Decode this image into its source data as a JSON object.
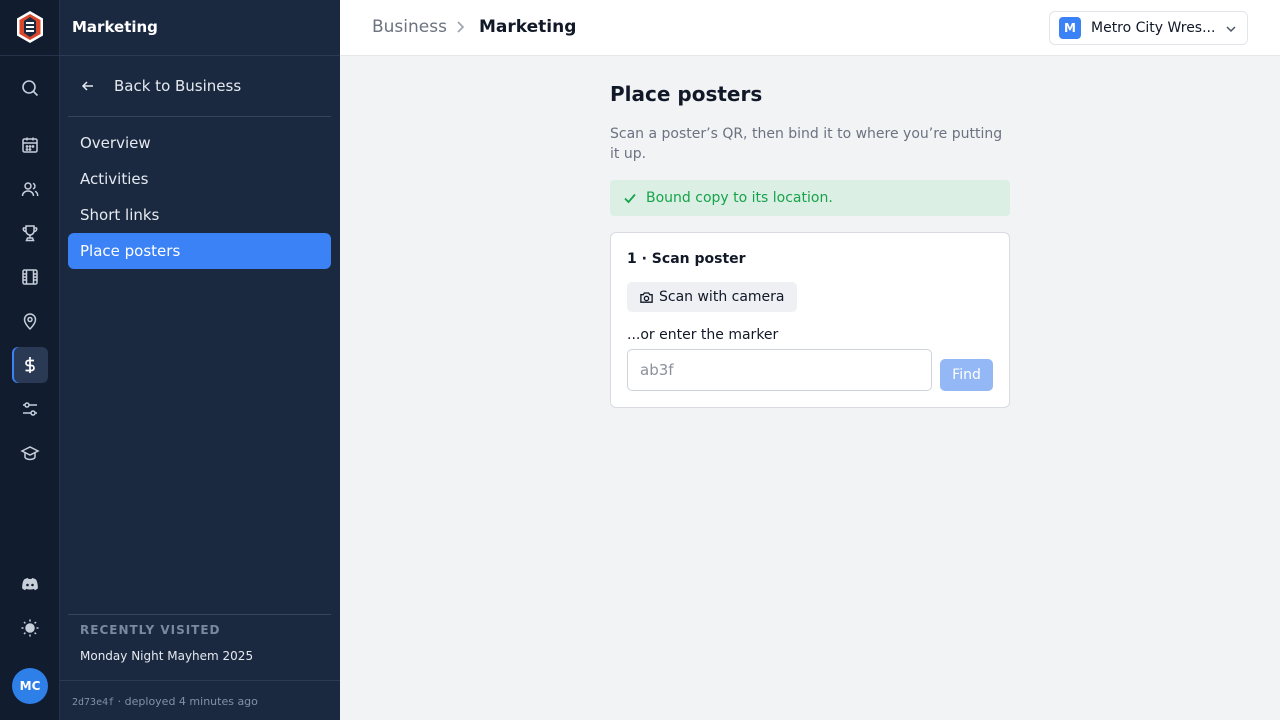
{
  "rail": {
    "avatar_initials": "MC",
    "icons": [
      "search-icon",
      "calendar-icon",
      "users-icon",
      "trophy-icon",
      "film-icon",
      "location-pin-icon",
      "dollar-icon",
      "sliders-icon",
      "graduation-cap-icon",
      "discord-icon",
      "sun-icon"
    ]
  },
  "sidebar": {
    "title": "Marketing",
    "back_label": "Back to Business",
    "items": [
      {
        "label": "Overview"
      },
      {
        "label": "Activities"
      },
      {
        "label": "Short links"
      },
      {
        "label": "Place posters"
      }
    ],
    "recent_heading": "RECENTLY VISITED",
    "recent_items": [
      {
        "label": "Monday Night Mayhem 2025"
      }
    ],
    "deploy_hash": "2d73e4f",
    "deploy_text": "· deployed 4 minutes ago"
  },
  "header": {
    "breadcrumb": [
      "Business",
      "Marketing"
    ],
    "org_initial": "M",
    "org_name": "Metro City Wres..."
  },
  "main": {
    "title": "Place posters",
    "subtitle": "Scan a poster’s QR, then bind it to where you’re putting it up.",
    "alert_text": "Bound copy to its location.",
    "card": {
      "title": "1 · Scan poster",
      "scan_button": "Scan with camera",
      "marker_label": "...or enter the marker",
      "marker_placeholder": "ab3f",
      "marker_value": "",
      "find_button": "Find"
    }
  },
  "colors": {
    "accent": "#3b82f6",
    "success": "#16a34a",
    "success_bg": "#dcefe5",
    "sidebar_bg": "#1b2940",
    "rail_bg": "#111c2e"
  }
}
